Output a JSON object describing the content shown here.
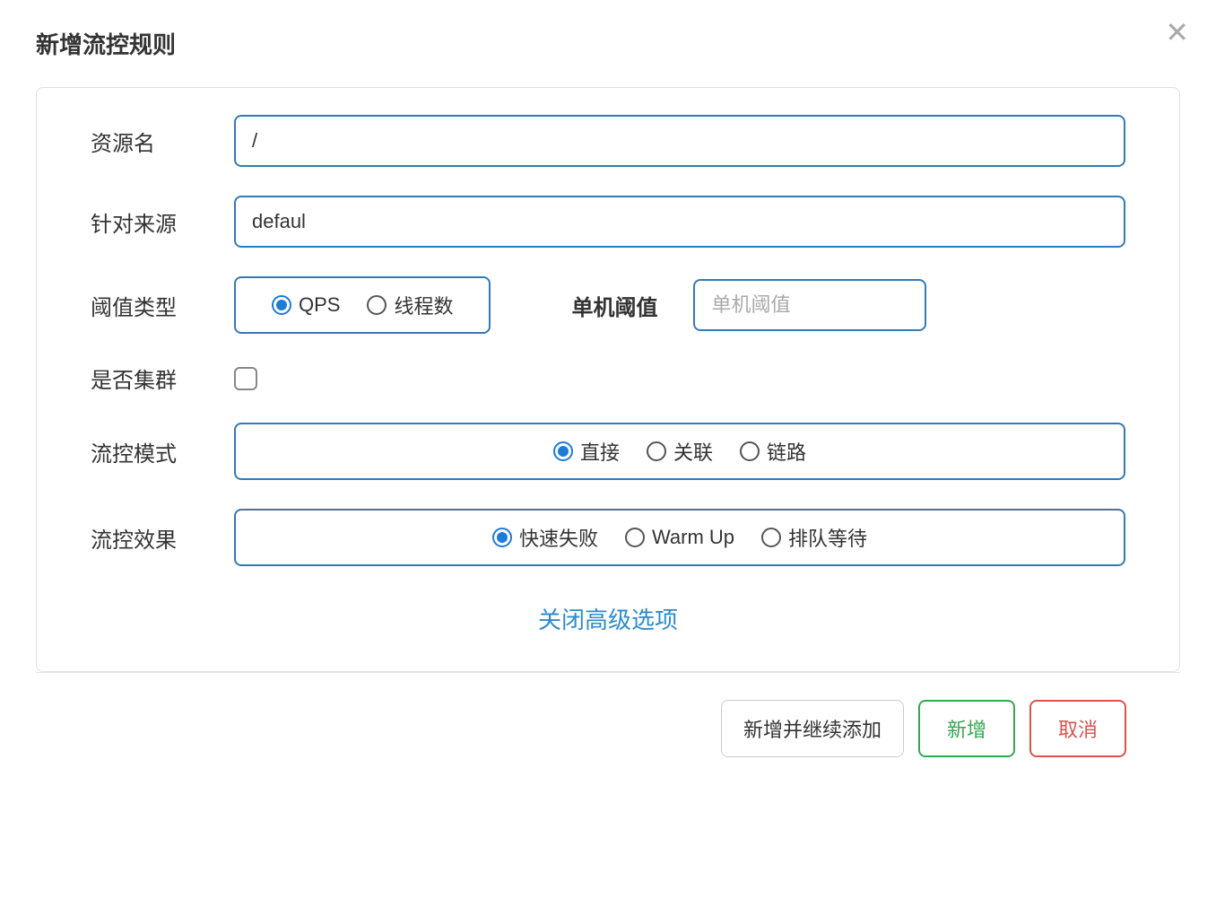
{
  "modal": {
    "title": "新增流控规则",
    "close_advanced": "关闭高级选项"
  },
  "form": {
    "resource_label": "资源名",
    "resource_value": "/",
    "source_label": "针对来源",
    "source_value": "defaul",
    "threshold_type_label": "阈值类型",
    "threshold_type_options": {
      "qps": "QPS",
      "threads": "线程数"
    },
    "single_threshold_label": "单机阈值",
    "single_threshold_placeholder": "单机阈值",
    "cluster_label": "是否集群",
    "mode_label": "流控模式",
    "mode_options": {
      "direct": "直接",
      "related": "关联",
      "chain": "链路"
    },
    "effect_label": "流控效果",
    "effect_options": {
      "fail_fast": "快速失败",
      "warm_up": "Warm Up",
      "queue": "排队等待"
    }
  },
  "footer": {
    "add_continue": "新增并继续添加",
    "add": "新增",
    "cancel": "取消"
  }
}
